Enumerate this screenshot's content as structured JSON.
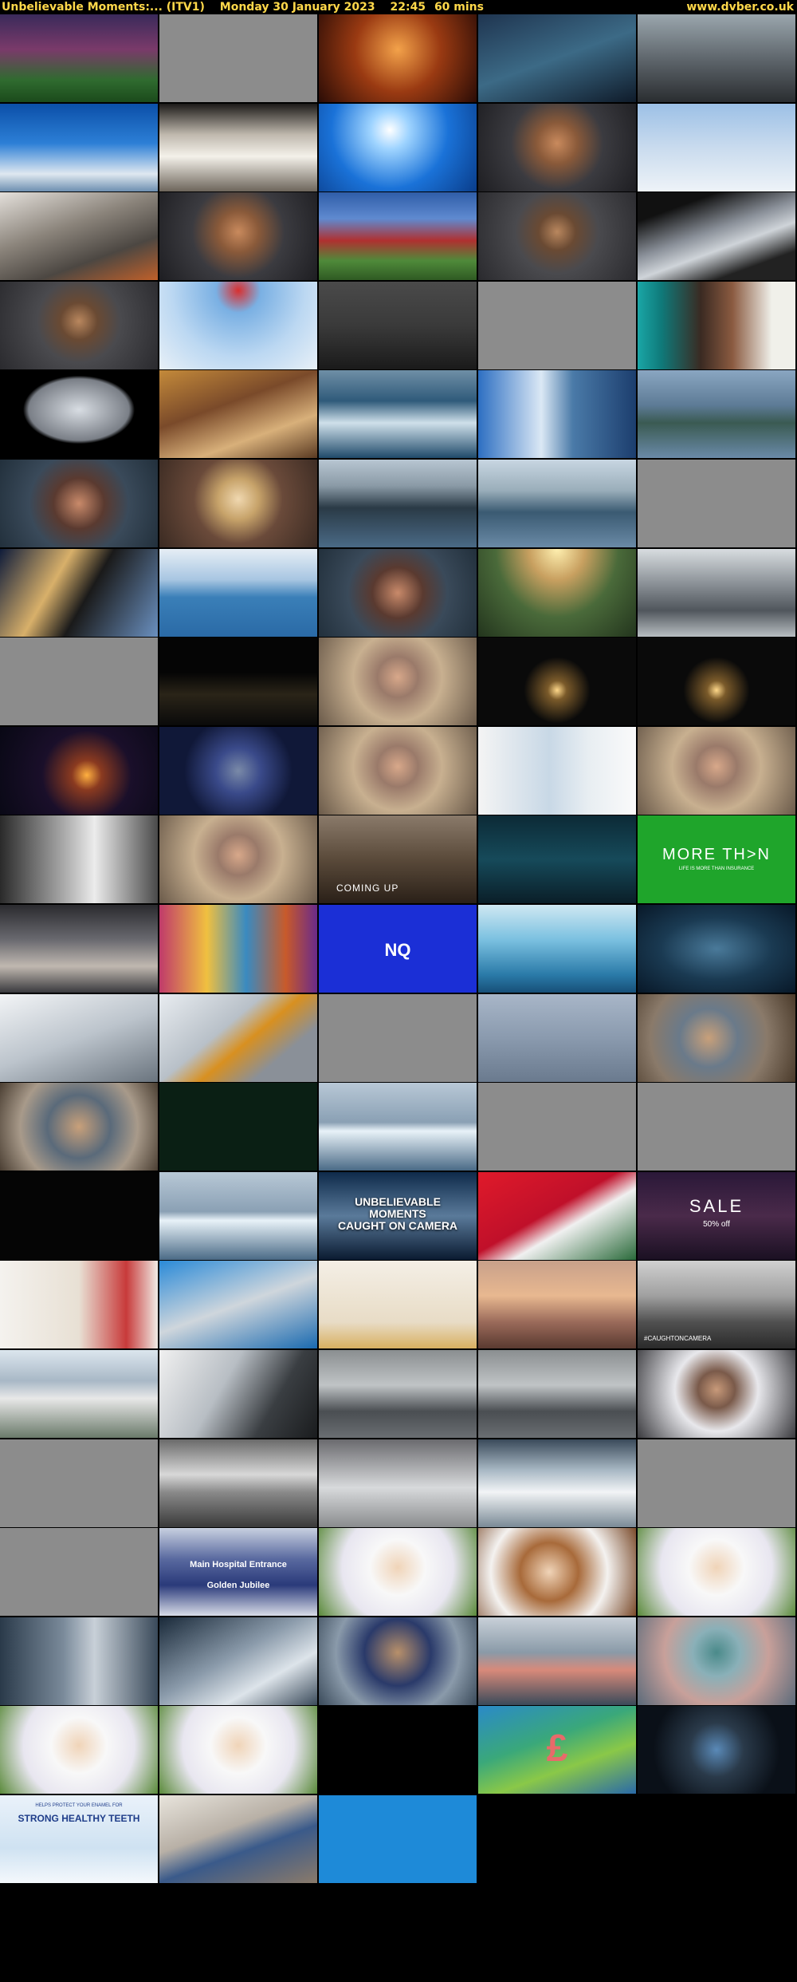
{
  "header": {
    "programme": "Unbelievable Moments:... (ITV1)",
    "date": "Monday 30 January 2023",
    "time": "22:45",
    "duration": "60 mins",
    "site": "www.dvber.co.uk"
  },
  "grid": {
    "columns": 5,
    "rows": 22,
    "frames": [
      "football-match",
      "grey",
      "orange-lights",
      "surgery",
      "car-interior",
      "skydivers",
      "parachute",
      "blue-sky",
      "man-ginger-beard",
      "blue-sky-pale",
      "skydive-gear",
      "man-ginger-beard",
      "field-house",
      "man-dark-beard",
      "phone-screen",
      "man-dark-beard",
      "kite-sky",
      "kitchen-dark",
      "grey",
      "tv-host",
      "eiffel-tower",
      "wedding-couple",
      "surf-waves",
      "diver-water",
      "seal-rocks",
      "woman-dark-hair",
      "woman-blonde",
      "whale-jump",
      "whale-dive",
      "grey",
      "kayak-drone",
      "kayak-sea",
      "woman-dark-hair",
      "aerial-sunset",
      "motorway",
      "grey",
      "night-road",
      "man-grey-hair",
      "night-road-lights",
      "night-road-lights",
      "night-fire",
      "night-police",
      "man-grey-hair",
      "hospital-bed",
      "man-grey-hair",
      "window-room",
      "man-grey-hair",
      "man-cap-coming-up",
      "router-ad",
      "more-than",
      "train-ad",
      "fabric-market",
      "nq-logo",
      "underwater-legs",
      "ocean-dark",
      "snow-slope",
      "snow-object",
      "grey",
      "boats-calm",
      "man-cap",
      "man-cap-gesture",
      "dark-green",
      "iceberg",
      "grey",
      "grey",
      "black",
      "iceberg",
      "umc-logo",
      "red-graphic",
      "sale-ad",
      "fairtrade-ad",
      "dental-tools",
      "gold-sofa-ad",
      "sunset-bathers",
      "police-cars",
      "city-skyline",
      "car-driver",
      "car-park",
      "car-park",
      "young-man",
      "grey",
      "blur-street",
      "car-park-snow",
      "car-white",
      "grey",
      "grey",
      "hospital-sign",
      "woman-blonde-flowers",
      "woman-violin",
      "woman-blonde-flowers",
      "operating-theatre",
      "operating-robot",
      "doctor-suit",
      "surgery-robot",
      "surgery-cap",
      "woman-blonde-flowers",
      "woman-blonde-flowers",
      "black-credits",
      "pound-map",
      "cooker-hob",
      "toothpaste-ad",
      "kitchen-woman",
      "phone-app",
      "empty",
      "empty",
      "empty",
      "empty"
    ],
    "captions": {
      "coming_up": "COMING UP",
      "more_than": "MORE TH>N",
      "more_than_tag": "LIFE IS MORE THAN INSURANCE",
      "nq": "NQ",
      "umc_line1": "UNBELIEVABLE",
      "umc_line2": "MOMENTS",
      "umc_line3": "CAUGHT ON CAMERA",
      "sale": "SALE",
      "sale_pct": "50% off",
      "teeth_top": "HELPS PROTECT YOUR ENAMEL FOR",
      "teeth": "STRONG HEALTHY TEETH",
      "hospital_sign": "Main Hospital Entrance",
      "hospital_sign2": "Golden Jubilee",
      "pound": "£",
      "hashtag": "#CAUGHTONCAMERA"
    },
    "colors": {
      "grey": "#8c8c8c",
      "black": "#000000",
      "green": "#1fa52b",
      "blue": "#1b2fd6"
    }
  }
}
